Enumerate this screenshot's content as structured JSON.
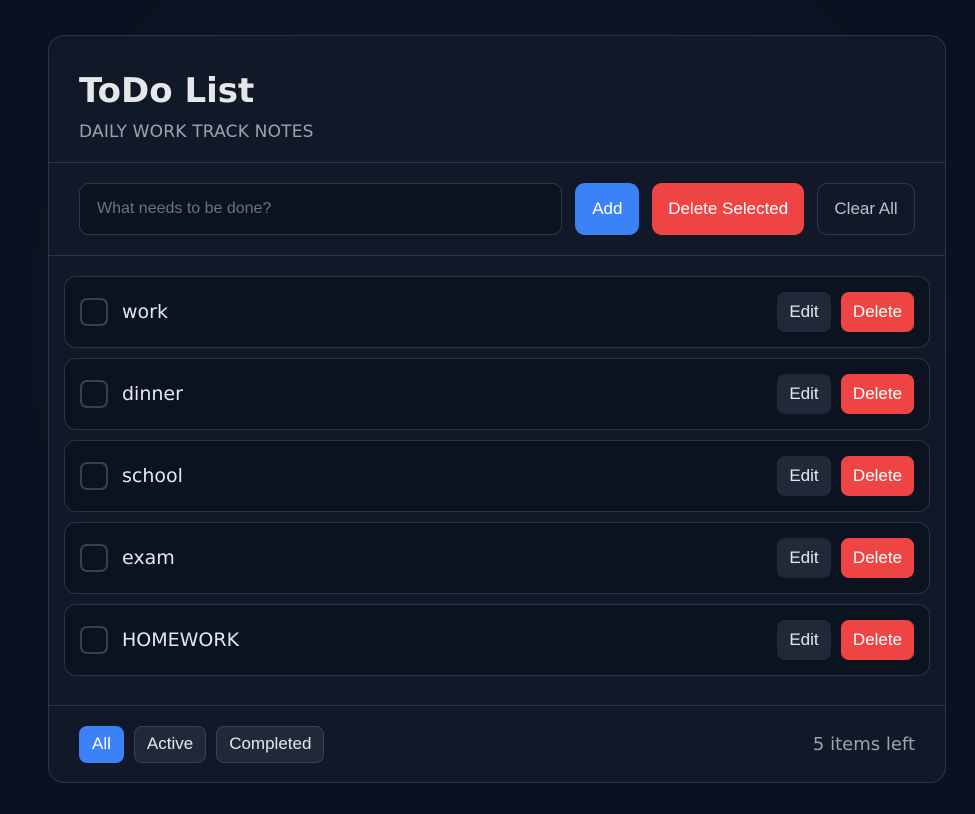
{
  "header": {
    "title": "ToDo List",
    "subtitle": "DAILY WORK TRACK NOTES"
  },
  "input": {
    "placeholder": "What needs to be done?",
    "value": ""
  },
  "toolbar": {
    "add_label": "Add",
    "delete_selected_label": "Delete Selected",
    "clear_all_label": "Clear All"
  },
  "todos": [
    {
      "text": "work",
      "edit_label": "Edit",
      "delete_label": "Delete",
      "checked": false
    },
    {
      "text": "dinner",
      "edit_label": "Edit",
      "delete_label": "Delete",
      "checked": false
    },
    {
      "text": "school",
      "edit_label": "Edit",
      "delete_label": "Delete",
      "checked": false
    },
    {
      "text": "exam",
      "edit_label": "Edit",
      "delete_label": "Delete",
      "checked": false
    },
    {
      "text": "HOMEWORK",
      "edit_label": "Edit",
      "delete_label": "Delete",
      "checked": false
    }
  ],
  "footer": {
    "filters": [
      {
        "label": "All",
        "selected": true
      },
      {
        "label": "Active",
        "selected": false
      },
      {
        "label": "Completed",
        "selected": false
      }
    ],
    "items_left": "5 items left"
  },
  "colors": {
    "accent": "#3b82f6",
    "danger": "#ef4444",
    "background": "#111827"
  }
}
